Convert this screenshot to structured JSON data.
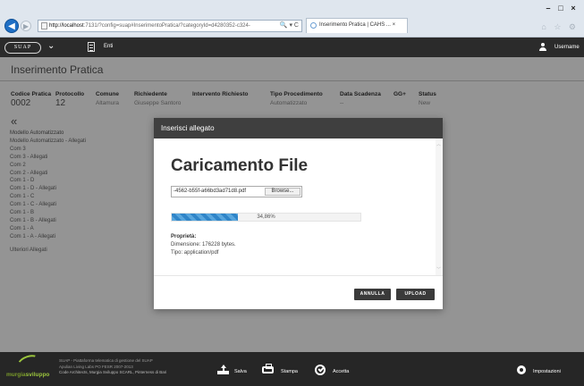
{
  "browser": {
    "url_host": "http://localhost",
    "url_rest": ":7131/?config=suap#InserimentoPratica/?categoryId=d4280352-c324-",
    "url_tools": "🔍 ▾ C",
    "tab_title": "Inserimento Pratica | CAHS ...",
    "tab_close": "×",
    "window_buttons": [
      "–",
      "□",
      "×"
    ],
    "toolbar_icons": "⌂ ☆ ⚙"
  },
  "appbar": {
    "logo": "SUAP",
    "enti_label": "Enti",
    "username": "Username"
  },
  "page": {
    "title": "Inserimento Pratica",
    "collapse_glyph": "«"
  },
  "summary": [
    {
      "label": "Codice Pratica",
      "value": "0002",
      "big": true
    },
    {
      "label": "Protocollo",
      "value": "12",
      "big": true
    },
    {
      "label": "Comune",
      "value": "Altamura",
      "big": false
    },
    {
      "label": "Richiedente",
      "value": "Giuseppe Santoro",
      "big": false
    },
    {
      "label": "Intervento Richiesto",
      "value": "",
      "big": false
    },
    {
      "label": "Tipo Procedimento",
      "value": "Automatizzato",
      "big": false
    },
    {
      "label": "Data Scadenza",
      "value": "--",
      "big": false
    },
    {
      "label": "GG+",
      "value": "",
      "big": false
    },
    {
      "label": "Status",
      "value": "New",
      "big": false
    }
  ],
  "sidebar": {
    "items": [
      "Modello Automatizzato",
      "Modello Automatizzato - Allegati",
      "Com 3",
      "Com 3 - Allegati",
      "Com 2",
      "Com 2 - Allegati",
      "Com 1 - D",
      "Com 1 - D - Allegati",
      "Com 1 - C",
      "Com 1 - C - Allegati",
      "Com 1 - B",
      "Com 1 - B - Allegati",
      "Com 1 - A",
      "Com 1 - A - Allegati"
    ],
    "extra_item": "Ulteriori Allegati"
  },
  "modal": {
    "header": "Inserisci allegato",
    "title": "Caricamento File",
    "file_name": "-4562-b55f-a66bd3ad71d8.pdf",
    "browse_label": "Browse...",
    "progress_label": "34,86%",
    "progress_fraction": 0.3486,
    "props_title": "Proprietà:",
    "props_size": "Dimensione: 176228 bytes.",
    "props_type": "Tipo: application/pdf",
    "cancel_label": "ANNULLA",
    "upload_label": "UPLOAD"
  },
  "footer": {
    "logo_main": "murgia",
    "logo_sub": "sviluppo",
    "info_line1": "SUAP - Piattaforma telematica di gestione del SUAP",
    "info_line2": "Apulian Living Labs PO FESR 2007-2013",
    "info_line3": "Code Architects, Murgia Sviluppo SCARL, Pinterness di Bari",
    "save_label": "Salva",
    "print_label": "Stampa",
    "accept_label": "Accetta",
    "settings_label": "Impostazioni"
  },
  "colors": {
    "accent_blue": "#2f85c8",
    "header_dark": "#2b2b2b",
    "brand_green": "#9bc53d"
  }
}
